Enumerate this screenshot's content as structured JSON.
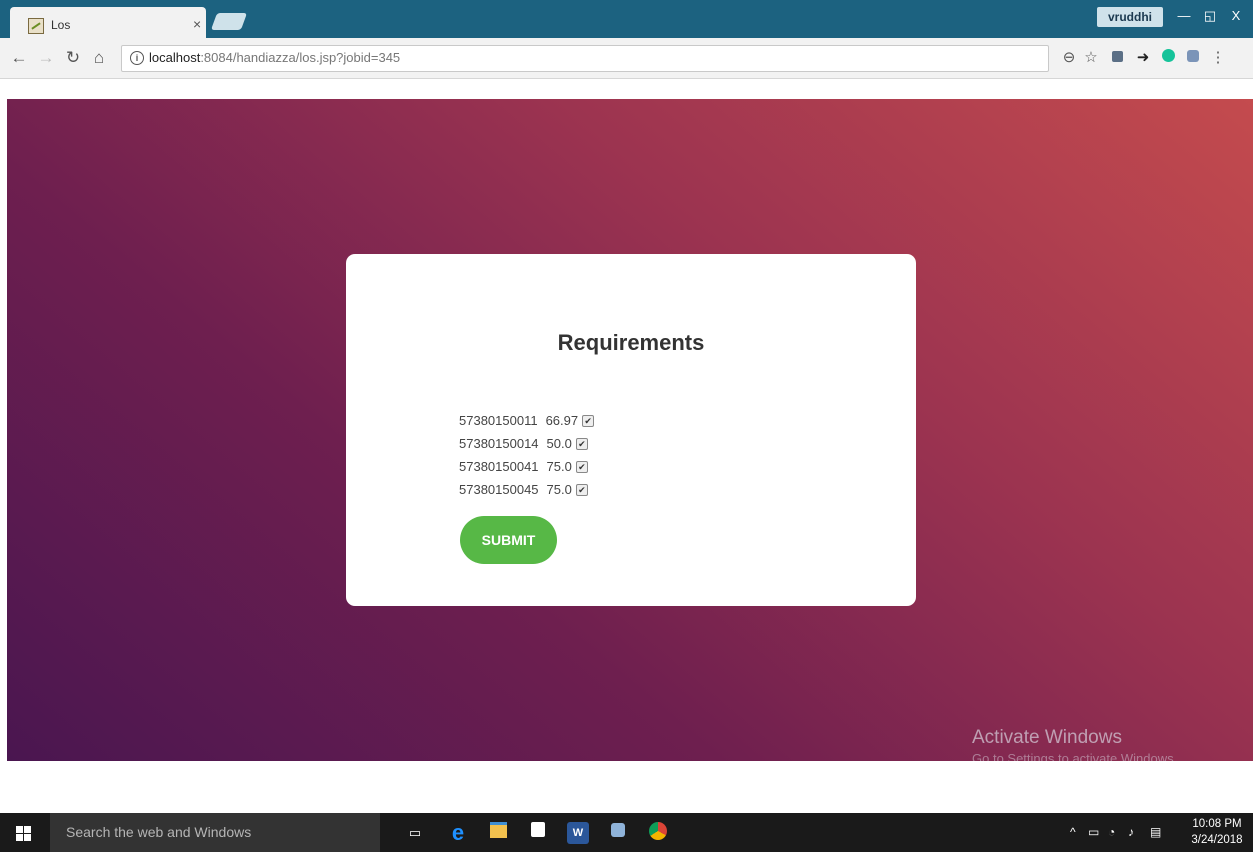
{
  "browser": {
    "tab_title": "Los",
    "tab_close": "×",
    "user_name": "vruddhi",
    "window_controls": {
      "minimize": "—",
      "restore": "◱",
      "close": "X"
    },
    "url_host": "localhost",
    "url_rest": ":8084/handiazza/los.jsp?jobid=345"
  },
  "card": {
    "title": "Requirements",
    "rows": [
      {
        "id": "57380150011",
        "value": "66.97",
        "checked": true
      },
      {
        "id": "57380150014",
        "value": "50.0",
        "checked": true
      },
      {
        "id": "57380150041",
        "value": "75.0",
        "checked": true
      },
      {
        "id": "57380150045",
        "value": "75.0",
        "checked": true
      }
    ],
    "submit_label": "SUBMIT"
  },
  "watermark": {
    "title": "Activate Windows",
    "subtitle": "Go to Settings to activate Windows."
  },
  "taskbar": {
    "search_placeholder": "Search the web and Windows",
    "time": "10:08 PM",
    "date": "3/24/2018"
  },
  "colors": {
    "titlebar": "#1c6280",
    "submit": "#57b846",
    "gradient_start": "#4a1650",
    "gradient_end": "#c44b4e"
  }
}
